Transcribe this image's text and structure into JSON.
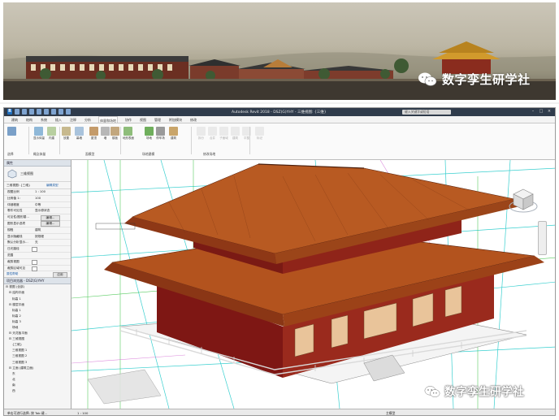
{
  "banner": {
    "watermark": "数字孪生研学社",
    "icon": "wechat-icon"
  },
  "revit": {
    "title": "Autodesk Revit 2018 -   DSZ(G)YHY - 三维视图: {三维}",
    "search_placeholder": "键入关键字或短语",
    "tabs": [
      "建筑",
      "结构",
      "系统",
      "插入",
      "注释",
      "分析",
      "体量和场地",
      "协作",
      "视图",
      "管理",
      "附加模块",
      "修改"
    ],
    "active_tab": "体量和场地",
    "ribbon": {
      "buttons": [
        {
          "label": "显示体量\n形状和楼层",
          "icon": "mass-show-icon",
          "color": "#8fb8d8"
        },
        {
          "label": "内建\n体量",
          "icon": "inplace-mass-icon",
          "color": "#b8cfa0"
        },
        {
          "label": "放置\n体量",
          "icon": "place-mass-icon",
          "color": "#c7b98e"
        },
        {
          "label": "幕墙\n系统",
          "icon": "curtain-system-icon",
          "color": "#a9c3dc"
        },
        {
          "label": "屋顶",
          "icon": "roof-icon",
          "color": "#c49b6a"
        },
        {
          "label": "墙",
          "icon": "wall-icon",
          "color": "#b7b7b7"
        },
        {
          "label": "楼板",
          "icon": "floor-icon",
          "color": "#c2a77e"
        },
        {
          "label": "地形表面",
          "icon": "toposurface-icon",
          "color": "#8ebd7a"
        },
        {
          "label": "场地\n构件",
          "icon": "site-component-icon",
          "color": "#6fae5c"
        },
        {
          "label": "停车场\n构件",
          "icon": "parking-icon",
          "color": "#9a9a9a"
        },
        {
          "label": "建筑\n地坪",
          "icon": "building-pad-icon",
          "color": "#c9a56a"
        },
        {
          "label": "拆分\n表面",
          "icon": "split-surface-icon",
          "color": "#cccccc"
        },
        {
          "label": "合并\n表面",
          "icon": "merge-surface-icon",
          "color": "#cccccc"
        },
        {
          "label": "子面域",
          "icon": "subregion-icon",
          "color": "#cccccc"
        },
        {
          "label": "建筑\n红线",
          "icon": "property-line-icon",
          "color": "#cccccc"
        },
        {
          "label": "平整\n区域",
          "icon": "graded-region-icon",
          "color": "#cccccc"
        },
        {
          "label": "标记\n等高线",
          "icon": "label-contours-icon",
          "color": "#cccccc"
        }
      ],
      "panels": [
        "选择",
        "概念体量",
        "面模型",
        "场地建模",
        "修改场地"
      ]
    },
    "properties": {
      "header": "属性",
      "type_name": "三维视图",
      "view_selector": "三维视图: {三维}",
      "edit_type": "编辑类型",
      "rows": [
        {
          "label": "视图比例",
          "value": "1 : 100"
        },
        {
          "label": "比例值 1:",
          "value": "100"
        },
        {
          "label": "详细程度",
          "value": "中等"
        },
        {
          "label": "零件可见性",
          "value": "显示原状态"
        },
        {
          "label": "可见性/图形替...",
          "value": "编辑..."
        },
        {
          "label": "图形显示选项",
          "value": "编辑..."
        },
        {
          "label": "规程",
          "value": "建筑"
        },
        {
          "label": "显示隐藏线",
          "value": "按规程"
        },
        {
          "label": "默认分析显示...",
          "value": "无"
        },
        {
          "label": "日光路径",
          "value": ""
        },
        {
          "label": "范围",
          "value": ""
        },
        {
          "label": "裁剪视图",
          "value": ""
        },
        {
          "label": "裁剪区域可见",
          "value": ""
        }
      ],
      "help": "属性帮助",
      "apply": "应用"
    },
    "browser": {
      "header": "项目浏览器 - DSZ(G)YHY",
      "items": [
        "视图 (全部)",
        "结构平面",
        "标高 1",
        "楼层平面",
        "标高 1",
        "标高 2",
        "标高 3",
        "场地",
        "天花板平面",
        "三维视图",
        "{三维}",
        "三维视图 1",
        "三维视图 2",
        "三维视图 3",
        "立面 (建筑立面)",
        "东",
        "北",
        "南",
        "西"
      ]
    },
    "status": {
      "left": "单击可进行选择; 按 Tab 键...",
      "scale": "1 : 100",
      "right": "主模型"
    }
  },
  "bottom_watermark": {
    "text": "数字孪生研学社",
    "icon": "wechat-icon"
  }
}
